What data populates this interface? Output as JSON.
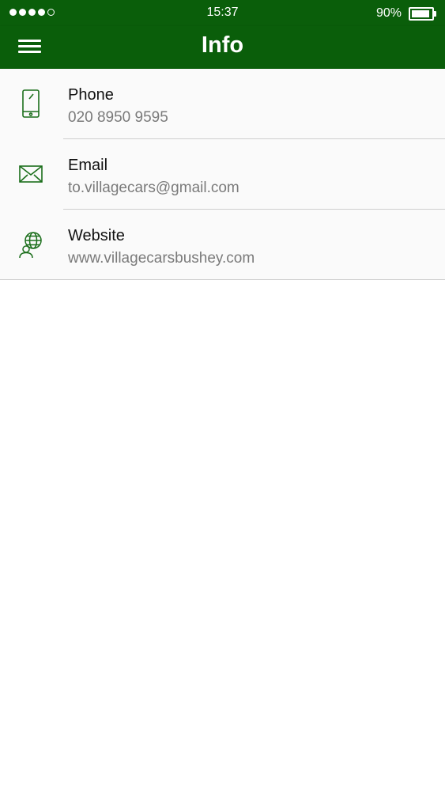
{
  "status_bar": {
    "time": "15:37",
    "battery_text": "90%",
    "battery_level": 0.9,
    "signal_bars_filled": 4,
    "signal_bars_total": 5
  },
  "app_bar": {
    "title": "Info",
    "menu_icon": "hamburger-menu-icon"
  },
  "colors": {
    "primary": "#0a5e0a",
    "icon": "#1b6e1b",
    "title_text": "#111111",
    "value_text": "#7a7a7a"
  },
  "items": [
    {
      "icon": "phone-icon",
      "title": "Phone",
      "value": "020 8950 9595"
    },
    {
      "icon": "email-icon",
      "title": "Email",
      "value": "to.villagecars@gmail.com"
    },
    {
      "icon": "website-icon",
      "title": "Website",
      "value": "www.villagecarsbushey.com"
    }
  ]
}
